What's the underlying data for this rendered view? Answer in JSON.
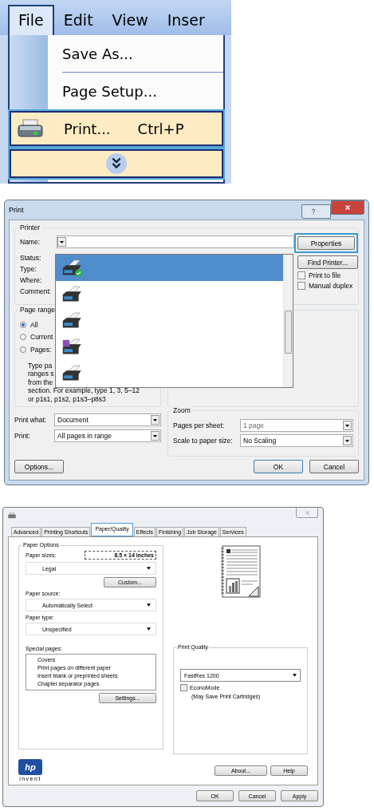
{
  "menu": {
    "bar": [
      {
        "label": "File",
        "selected": true
      },
      {
        "label": "Edit",
        "selected": false
      },
      {
        "label": "View",
        "selected": false
      },
      {
        "label": "Inser",
        "selected": false
      }
    ],
    "entries": [
      {
        "kind": "item",
        "label": "Save As...",
        "highlighted": false
      },
      {
        "kind": "item",
        "label": "Page Setup...",
        "highlighted": false
      },
      {
        "kind": "command",
        "label": "Print...",
        "shortcut": "Ctrl+P",
        "highlighted": true
      },
      {
        "kind": "expand",
        "highlighted": true
      }
    ]
  },
  "print_dialog": {
    "title": "Print",
    "printer_group": "Printer",
    "name_label": "Name:",
    "info_labels": [
      "Status:",
      "Type:",
      "Where:",
      "Comment:"
    ],
    "printer_list": [
      {
        "kind": "default",
        "selected": true
      },
      {
        "kind": "printer",
        "selected": false
      },
      {
        "kind": "printer",
        "selected": false
      },
      {
        "kind": "file",
        "selected": false
      },
      {
        "kind": "printer",
        "selected": false
      }
    ],
    "side_buttons": [
      {
        "label": "Properties",
        "highlighted": true
      },
      {
        "label": "Find Printer...",
        "highlighted": false
      }
    ],
    "checkboxes": [
      {
        "label": "Print to file",
        "checked": false
      },
      {
        "label": "Manual duplex",
        "checked": false
      }
    ],
    "page_range": {
      "title": "Page range",
      "options": [
        {
          "label": "All",
          "selected": true
        },
        {
          "label": "Current",
          "selected": false
        },
        {
          "label": "Pages:",
          "selected": false
        }
      ],
      "help_lines": [
        "Type pa",
        "ranges s",
        "from the",
        "section. For example, type 1, 3, 5–12",
        "or p1s1, p1s2, p1s3–p8s3"
      ]
    },
    "fields": [
      {
        "label": "Print what:",
        "value": "Document"
      },
      {
        "label": "Print:",
        "value": "All pages in range"
      }
    ],
    "zoom": {
      "title": "Zoom",
      "fields": [
        {
          "label": "Pages per sheet:",
          "value": "1 page",
          "disabled": true
        },
        {
          "label": "Scale to paper size:",
          "value": "No Scaling",
          "disabled": false
        }
      ]
    },
    "buttons": [
      "Options...",
      "OK",
      "Cancel"
    ]
  },
  "driver_dialog": {
    "tabs": [
      {
        "label": "Advanced",
        "selected": false
      },
      {
        "label": "Printing Shortcuts",
        "selected": false
      },
      {
        "label": "Paper/Quality",
        "selected": true
      },
      {
        "label": "Effects",
        "selected": false
      },
      {
        "label": "Finishing",
        "selected": false
      },
      {
        "label": "Job Storage",
        "selected": false
      },
      {
        "label": "Services",
        "selected": false
      }
    ],
    "paper_options": {
      "title": "Paper Options",
      "size_label": "Paper sizes:",
      "size_value": "8.5 × 14 inches",
      "size": "Legal",
      "custom_button": "Custom...",
      "source_label": "Paper source:",
      "source": "Automatically Select",
      "type_label": "Paper type:",
      "type": "Unspecified",
      "special_label": "Special pages:",
      "special_pages": [
        "Covers",
        "Print pages on different paper",
        "Insert blank or preprinted sheets",
        "Chapter separator pages"
      ],
      "settings_button": "Settings..."
    },
    "print_quality": {
      "title": "Print Quality",
      "value": "FastRes 1200",
      "econo": {
        "label": "EconoMode",
        "note": "(May Save Print Cartridges)",
        "checked": false
      }
    },
    "logo": {
      "mark": "hp",
      "tagline": "invent"
    },
    "inner_buttons": [
      "About...",
      "Help"
    ],
    "buttons": [
      "OK",
      "Cancel",
      "Apply"
    ]
  }
}
